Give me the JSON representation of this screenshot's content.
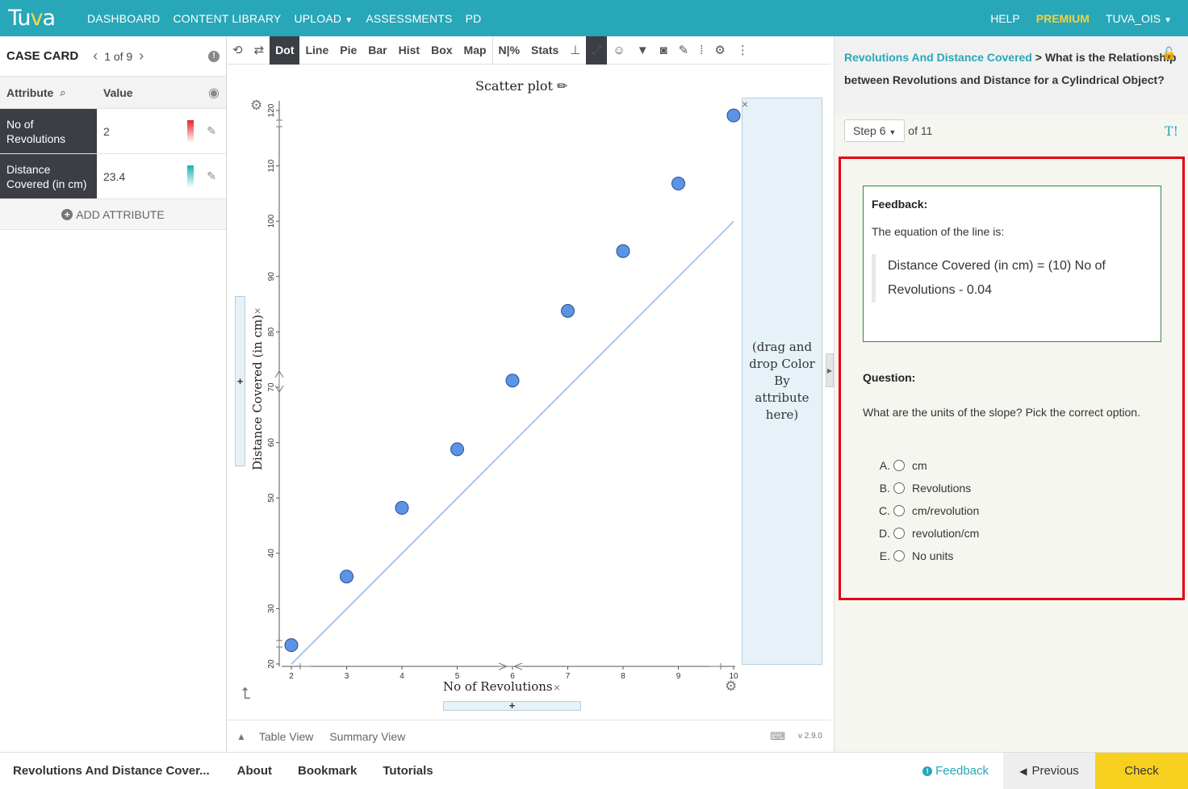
{
  "nav": {
    "logo": "Tuva",
    "items": [
      "DASHBOARD",
      "CONTENT LIBRARY",
      "UPLOAD",
      "ASSESSMENTS",
      "PD"
    ],
    "help": "HELP",
    "premium": "PREMIUM",
    "user": "TUVA_OIS"
  },
  "casecard": {
    "title": "CASE CARD",
    "position": "1 of 9",
    "attr_header": "Attribute",
    "value_header": "Value",
    "rows": [
      {
        "name": "No of Revolutions",
        "value": "2",
        "color": "#e8222a"
      },
      {
        "name": "Distance Covered (in cm)",
        "value": "23.4",
        "color": "#18b5b0"
      }
    ],
    "add_attribute": "ADD ATTRIBUTE"
  },
  "toolbar": {
    "tabs": [
      "Dot",
      "Line",
      "Pie",
      "Bar",
      "Hist",
      "Box",
      "Map",
      "N|%",
      "Stats"
    ],
    "active": "Dot"
  },
  "graph": {
    "title": "Scatter plot",
    "drop_hint": "(drag and drop Color By attribute here)",
    "plus": "+",
    "bottom_tabs": [
      "Table View",
      "Summary View"
    ],
    "version": "v 2.9.0"
  },
  "chart_data": {
    "type": "scatter",
    "title": "Scatter plot",
    "xlabel": "No of Revolutions",
    "ylabel": "Distance Covered (in cm)",
    "xlim": [
      2,
      10
    ],
    "ylim": [
      20,
      120
    ],
    "x_ticks": [
      2,
      3,
      4,
      5,
      6,
      7,
      8,
      9,
      10
    ],
    "y_ticks": [
      20,
      30,
      40,
      50,
      60,
      70,
      80,
      90,
      100,
      110,
      120
    ],
    "points": [
      {
        "x": 2,
        "y": 23.4
      },
      {
        "x": 3,
        "y": 35.8
      },
      {
        "x": 4,
        "y": 48.2
      },
      {
        "x": 5,
        "y": 58.8
      },
      {
        "x": 6,
        "y": 71.2
      },
      {
        "x": 7,
        "y": 83.8
      },
      {
        "x": 8,
        "y": 94.6
      },
      {
        "x": 9,
        "y": 106.8
      },
      {
        "x": 10,
        "y": 119.1
      }
    ],
    "line": {
      "slope": 10,
      "intercept": -0.04
    },
    "point_color": "#5b93e6",
    "line_color": "#a7c8ea"
  },
  "lesson": {
    "link": "Revolutions And Distance Covered",
    "separator": ">",
    "title": "What is the Relationship between Revolutions and Distance for a Cylindrical Object?",
    "step": "Step 6",
    "of": "of 11",
    "tt": "T!",
    "feedback_title": "Feedback:",
    "feedback_text": "The equation of the line is:",
    "feedback_equation": "Distance Covered (in cm) = (10) No of Revolutions - 0.04",
    "question_title": "Question:",
    "question_text": "What are the units of the slope? Pick the correct option.",
    "options": [
      {
        "letter": "A.",
        "text": "cm"
      },
      {
        "letter": "B.",
        "text": "Revolutions"
      },
      {
        "letter": "C.",
        "text": "cm/revolution"
      },
      {
        "letter": "D.",
        "text": "revolution/cm"
      },
      {
        "letter": "E.",
        "text": "No units"
      }
    ]
  },
  "footer": {
    "lesson_name": "Revolutions And Distance Cover...",
    "about": "About",
    "bookmark": "Bookmark",
    "tutorials": "Tutorials",
    "feedback": "Feedback",
    "previous": "Previous",
    "check": "Check"
  }
}
